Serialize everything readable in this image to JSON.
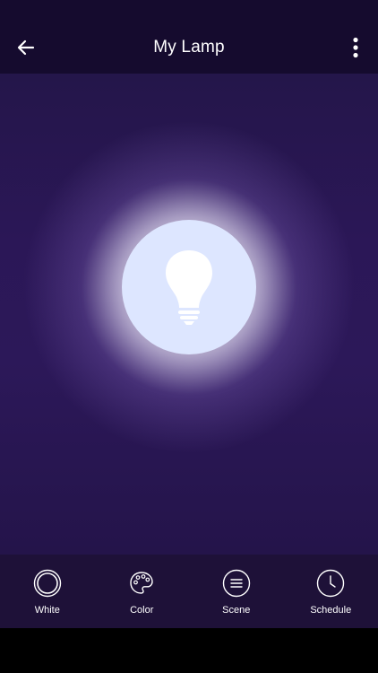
{
  "header": {
    "title": "My Lamp",
    "back_icon": "arrow-left-icon",
    "menu_icon": "more-vertical-icon"
  },
  "lamp": {
    "icon": "lightbulb-icon"
  },
  "tabs": [
    {
      "label": "White",
      "icon": "circle-icon"
    },
    {
      "label": "Color",
      "icon": "palette-icon"
    },
    {
      "label": "Scene",
      "icon": "scene-lines-icon"
    },
    {
      "label": "Schedule",
      "icon": "clock-icon"
    }
  ],
  "colors": {
    "header_bg": "#150b2e",
    "stage_bg": "#2b1757",
    "bulb_circle": "#dde6ff",
    "tab_bar_bg": "#1e1138",
    "text": "#ffffff"
  }
}
